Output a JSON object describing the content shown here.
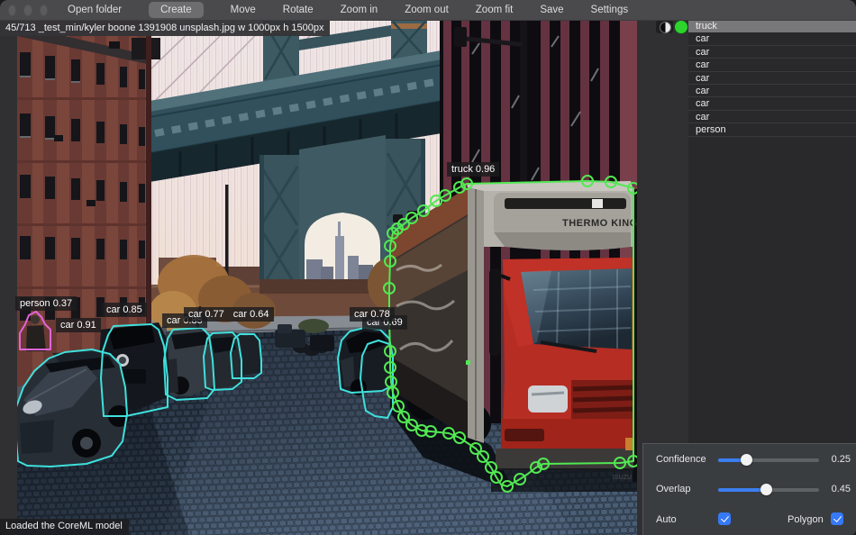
{
  "titlebar": {
    "buttons": [
      "Open folder",
      "Create",
      "Move",
      "Rotate",
      "Zoom in",
      "Zoom out",
      "Zoom fit",
      "Save",
      "Settings"
    ],
    "active_button": "Create"
  },
  "canvas": {
    "file_info": "45/713 _test_min/kyler boone 1391908 unsplash.jpg w 1000px h 1500px",
    "status_message": "Loaded the CoreML model",
    "photo_text": {
      "truck_brand": "THERMO KING",
      "truck_logo": "ISUZU"
    }
  },
  "detections": {
    "labels": [
      "truck 0.96",
      "person 0.37",
      "car 0.91",
      "car 0.85",
      "car 0.85",
      "car 0.77",
      "car 0.64",
      "car 0.78",
      "car 0.69"
    ]
  },
  "sidebar": {
    "selected_class": "truck",
    "items": [
      {
        "label": "truck",
        "selected": true
      },
      {
        "label": "car",
        "selected": false
      },
      {
        "label": "car",
        "selected": false
      },
      {
        "label": "car",
        "selected": false
      },
      {
        "label": "car",
        "selected": false
      },
      {
        "label": "car",
        "selected": false
      },
      {
        "label": "car",
        "selected": false
      },
      {
        "label": "car",
        "selected": false
      },
      {
        "label": "person",
        "selected": false
      }
    ]
  },
  "panel": {
    "confidence": {
      "label": "Confidence",
      "value": "0.25"
    },
    "overlap": {
      "label": "Overlap",
      "value": "0.45"
    },
    "auto": {
      "label": "Auto",
      "checked": true
    },
    "polygon": {
      "label": "Polygon",
      "checked": true
    }
  },
  "colors": {
    "accent_blue": "#3b7ef0",
    "polygon_green": "#52e852",
    "polygon_cyan": "#3fe0dc",
    "polygon_magenta": "#e264d8",
    "class_color_dot": "#2ed32e"
  }
}
